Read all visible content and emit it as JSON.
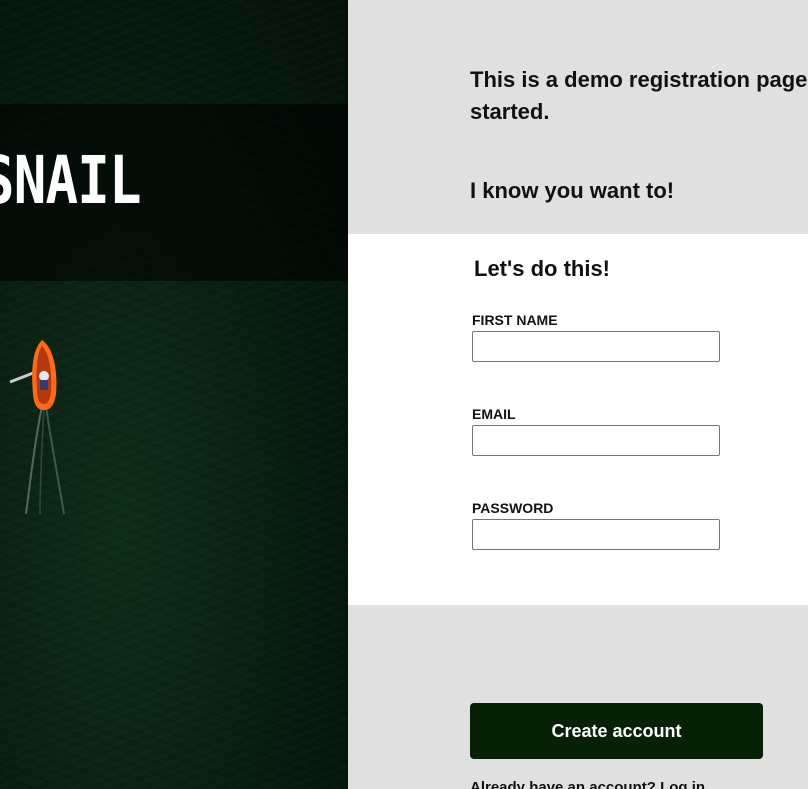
{
  "hero": {
    "brand_text": "SNAIL",
    "image_alt": "aerial view of orange rowboat on dark green water"
  },
  "intro": {
    "line1a": "This is a demo registration page",
    "line1b": "started.",
    "line2": "I know you want to!"
  },
  "form": {
    "title": "Let's do this!",
    "fields": [
      {
        "label": "FIRST NAME",
        "value": "",
        "placeholder": ""
      },
      {
        "label": "EMAIL",
        "value": "",
        "placeholder": ""
      },
      {
        "label": "PASSWORD",
        "value": "",
        "placeholder": ""
      }
    ]
  },
  "actions": {
    "create_label": "Create account",
    "login_prompt": "Already have an account?",
    "login_link": "Log in"
  },
  "colors": {
    "button_bg": "#062106",
    "panel_bg": "#e0e0e0",
    "card_bg": "#ffffff"
  }
}
